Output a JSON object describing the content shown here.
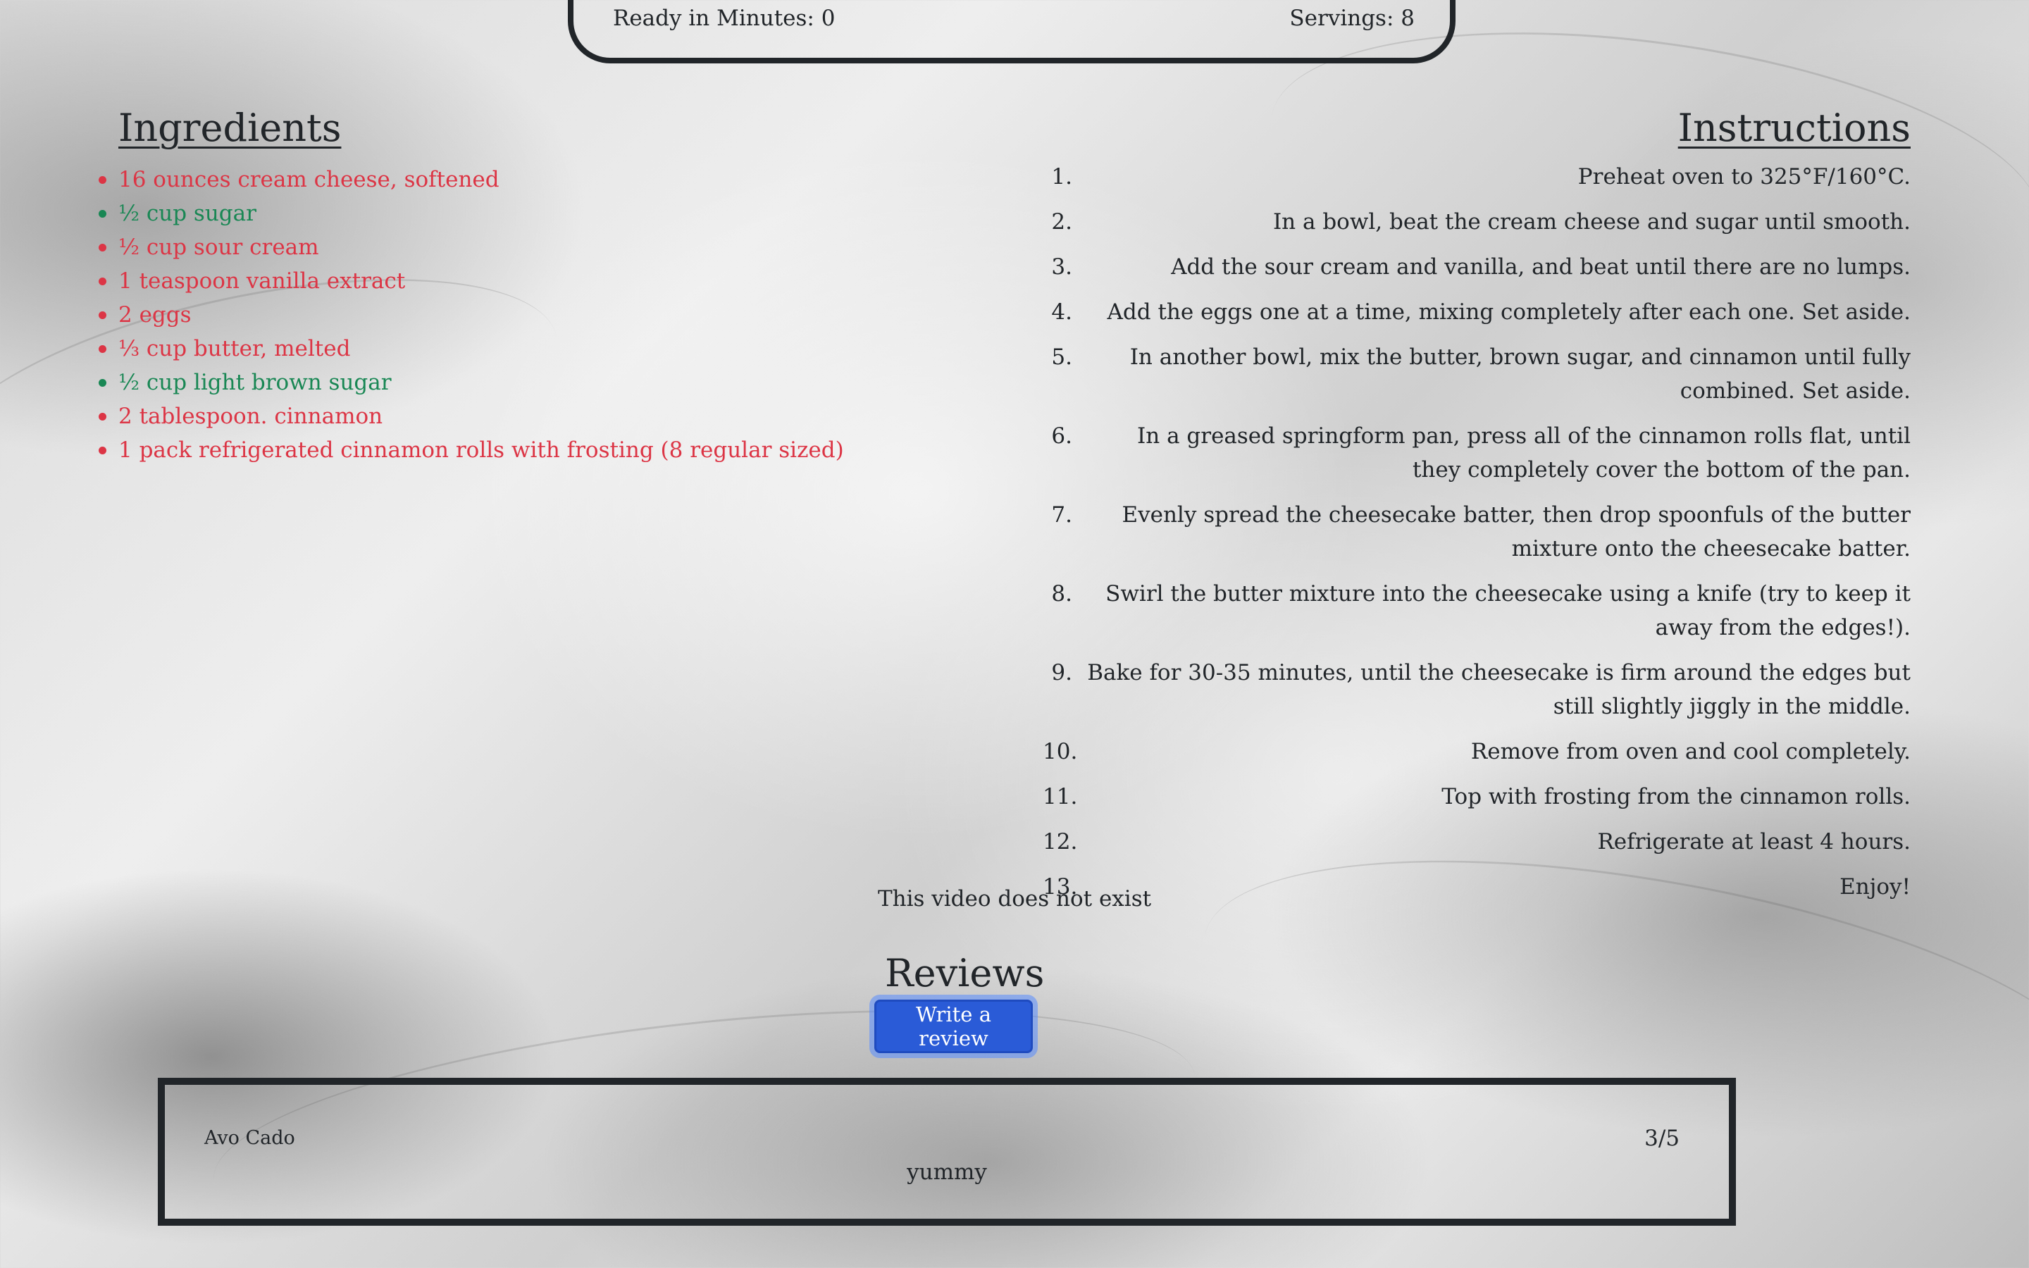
{
  "recipe_meta": {
    "ready_in": "Ready in Minutes: 0",
    "servings": "Servings: 8"
  },
  "ingredients": {
    "title": "Ingredients",
    "items": [
      {
        "text": "16 ounces cream cheese, softened",
        "color": "#dc3545"
      },
      {
        "text": "½ cup sugar",
        "color": "#198754"
      },
      {
        "text": "½ cup sour cream",
        "color": "#dc3545"
      },
      {
        "text": "1 teaspoon vanilla extract",
        "color": "#dc3545"
      },
      {
        "text": "2 eggs",
        "color": "#dc3545"
      },
      {
        "text": "⅓ cup butter, melted",
        "color": "#dc3545"
      },
      {
        "text": "½ cup light brown sugar",
        "color": "#198754"
      },
      {
        "text": "2 tablespoon. cinnamon",
        "color": "#dc3545"
      },
      {
        "text": "1 pack refrigerated cinnamon rolls with frosting (8 regular sized)",
        "color": "#dc3545"
      }
    ]
  },
  "instructions": {
    "title": "Instructions",
    "steps": [
      {
        "num": "1.",
        "text": "Preheat oven to 325°F/160°C."
      },
      {
        "num": "2.",
        "text": "In a bowl, beat the cream cheese and sugar until smooth."
      },
      {
        "num": "3.",
        "text": "Add the sour cream and vanilla, and beat until there are no lumps."
      },
      {
        "num": "4.",
        "text": "Add the eggs one at a time, mixing completely after each one. Set aside."
      },
      {
        "num": "5.",
        "text": "In another bowl, mix the butter, brown sugar, and cinnamon until fully combined. Set aside."
      },
      {
        "num": "6.",
        "text": "In a greased springform pan, press all of the cinnamon rolls flat, until they completely cover the bottom of the pan."
      },
      {
        "num": "7.",
        "text": "Evenly spread the cheesecake batter, then drop spoonfuls of the butter mixture onto the cheesecake batter."
      },
      {
        "num": "8.",
        "text": "Swirl the butter mixture into the cheesecake using a knife (try to keep it away from the edges!)."
      },
      {
        "num": "9.",
        "text": "Bake for 30-35 minutes, until the cheesecake is firm around the edges but still slightly jiggly in the middle."
      },
      {
        "num": "10.",
        "text": "Remove from oven and cool completely."
      },
      {
        "num": "11.",
        "text": "Top with frosting from the cinnamon rolls."
      },
      {
        "num": "12.",
        "text": "Refrigerate at least 4 hours."
      },
      {
        "num": "13.",
        "text": "Enjoy!"
      }
    ]
  },
  "video": {
    "message": "This video does not exist"
  },
  "reviews": {
    "title": "Reviews",
    "write_label": "Write a review",
    "button_color": "#2a5bd7",
    "items": [
      {
        "author": "Avo Cado",
        "rating": "3/5",
        "body": "yummy"
      }
    ]
  }
}
